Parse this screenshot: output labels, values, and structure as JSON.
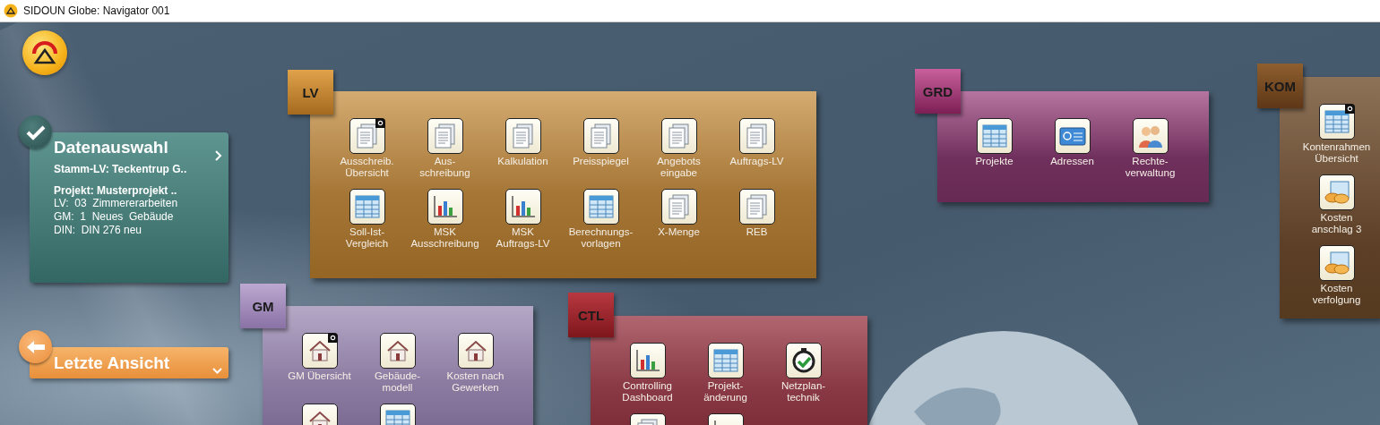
{
  "window": {
    "title": "SIDOUN Globe: Navigator 001"
  },
  "selection_card": {
    "title": "Datenauswahl",
    "stamm_lv": "Stamm-LV: Teckentrup G..",
    "project": "Projekt: Musterprojekt ..",
    "lines": [
      "LV:  03  Zimmererarbeiten",
      "GM:  1  Neues  Gebäude",
      "DIN:  DIN 276 neu"
    ]
  },
  "last_view": {
    "label": "Letzte Ansicht"
  },
  "sections": [
    {
      "tab": "LV",
      "items": [
        {
          "label": "Ausschreib. Übersicht",
          "badge": true,
          "kind": "document"
        },
        {
          "label": "Aus-schreibung",
          "badge": false,
          "kind": "document"
        },
        {
          "label": "Kalkulation",
          "badge": false,
          "kind": "document"
        },
        {
          "label": "Preisspiegel",
          "badge": false,
          "kind": "document"
        },
        {
          "label": "Angebots eingabe",
          "badge": false,
          "kind": "document"
        },
        {
          "label": "Auftrags-LV",
          "badge": false,
          "kind": "document"
        },
        {
          "label": "Soll-Ist-Vergleich",
          "badge": false,
          "kind": "table"
        },
        {
          "label": "MSK Ausschreibung",
          "badge": false,
          "kind": "chart"
        },
        {
          "label": "MSK Auftrags-LV",
          "badge": false,
          "kind": "chart"
        },
        {
          "label": "Berechnungs-vorlagen",
          "badge": false,
          "kind": "table"
        },
        {
          "label": "X-Menge",
          "badge": false,
          "kind": "document"
        },
        {
          "label": "REB",
          "badge": false,
          "kind": "document"
        }
      ]
    },
    {
      "tab": "GRD",
      "items": [
        {
          "label": "Projekte",
          "badge": false,
          "kind": "table"
        },
        {
          "label": "Adressen",
          "badge": false,
          "kind": "card"
        },
        {
          "label": "Rechte-verwaltung",
          "badge": false,
          "kind": "people"
        }
      ]
    },
    {
      "tab": "KOM",
      "items": [
        {
          "label": "Kontenrahmen Übersicht",
          "badge": true,
          "kind": "table"
        },
        {
          "label": "Kosten anschlag 3",
          "badge": false,
          "kind": "coins"
        },
        {
          "label": "Kosten verfolgung",
          "badge": false,
          "kind": "coins"
        }
      ]
    },
    {
      "tab": "GM",
      "items": [
        {
          "label": "GM Übersicht",
          "badge": true,
          "kind": "house"
        },
        {
          "label": "Gebäude-modell",
          "badge": false,
          "kind": "house"
        },
        {
          "label": "Kosten nach Gewerken",
          "badge": false,
          "kind": "house"
        },
        {
          "badge": false,
          "kind": "house"
        },
        {
          "badge": false,
          "kind": "table"
        }
      ]
    },
    {
      "tab": "CTL",
      "items": [
        {
          "label": "Controlling Dashboard",
          "badge": false,
          "kind": "chart"
        },
        {
          "label": "Projekt-änderung",
          "badge": false,
          "kind": "table"
        },
        {
          "label": "Netzplan-technik",
          "badge": false,
          "kind": "stopwatch"
        },
        {
          "badge": false,
          "kind": "document"
        },
        {
          "badge": false,
          "kind": "chart"
        }
      ]
    }
  ]
}
